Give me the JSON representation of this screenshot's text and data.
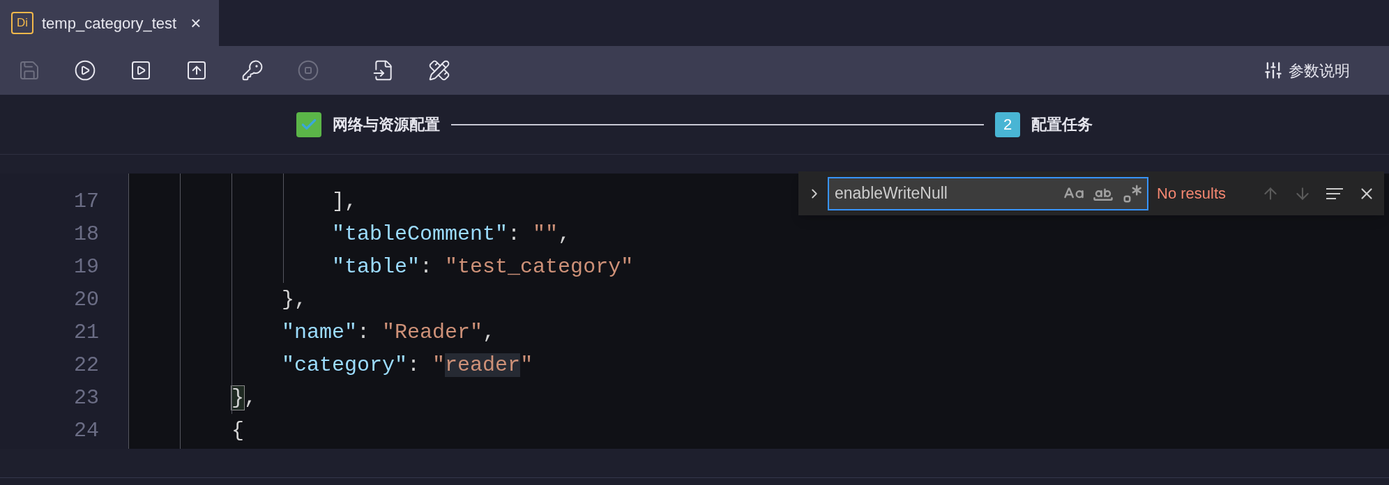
{
  "tab": {
    "badge": "Di",
    "title": "temp_category_test",
    "close": "×",
    "selected": true
  },
  "toolbar": {
    "buttons": [
      {
        "kind": "save",
        "disabled": true
      },
      {
        "kind": "run",
        "disabled": false
      },
      {
        "kind": "run_all",
        "disabled": false
      },
      {
        "kind": "submit",
        "disabled": false
      },
      {
        "kind": "key",
        "disabled": false
      },
      {
        "kind": "stop",
        "disabled": true
      },
      {
        "kind": "format",
        "disabled": false
      },
      {
        "kind": "tools",
        "disabled": false
      }
    ],
    "help": "参数说明"
  },
  "steps": [
    {
      "label": "网络与资源配置",
      "completed": true
    },
    {
      "label": "配置任务",
      "number": "2",
      "completed": false
    }
  ],
  "editor": {
    "lines": [
      {
        "number": "17",
        "tokens": [
          {
            "kind": "punct",
            "text": "                ],"
          }
        ]
      },
      {
        "number": "18",
        "tokens": [
          {
            "kind": "key",
            "text": "                \"tableComment\""
          },
          {
            "kind": "punct",
            "text": ": "
          },
          {
            "kind": "string",
            "text": "\"\""
          },
          {
            "kind": "punct",
            "text": ","
          }
        ]
      },
      {
        "number": "19",
        "tokens": [
          {
            "kind": "key",
            "text": "                \"table\""
          },
          {
            "kind": "punct",
            "text": ": "
          },
          {
            "kind": "string",
            "text": "\"test_category\""
          }
        ]
      },
      {
        "number": "20",
        "tokens": [
          {
            "kind": "punct",
            "text": "            },"
          }
        ]
      },
      {
        "number": "21",
        "tokens": [
          {
            "kind": "key",
            "text": "            \"name\""
          },
          {
            "kind": "punct",
            "text": ": "
          },
          {
            "kind": "string",
            "text": "\"Reader\""
          },
          {
            "kind": "punct",
            "text": ","
          }
        ]
      },
      {
        "number": "22",
        "tokens": [
          {
            "kind": "key",
            "text": "            \"category\""
          },
          {
            "kind": "punct",
            "text": ": "
          },
          {
            "kind": "string",
            "text": "\""
          },
          {
            "kind": "string_highlight",
            "text": "reader"
          },
          {
            "kind": "string",
            "text": "\""
          }
        ]
      },
      {
        "number": "23",
        "tokens": [
          {
            "kind": "bracket_match",
            "text": "        }"
          },
          {
            "kind": "punct",
            "text": ","
          }
        ]
      },
      {
        "number": "24",
        "tokens": [
          {
            "kind": "punct",
            "text": "        {"
          }
        ]
      }
    ],
    "find": {
      "value": "enableWriteNull",
      "result": "No results",
      "match_case": false,
      "whole_word": false,
      "regex": false
    }
  }
}
